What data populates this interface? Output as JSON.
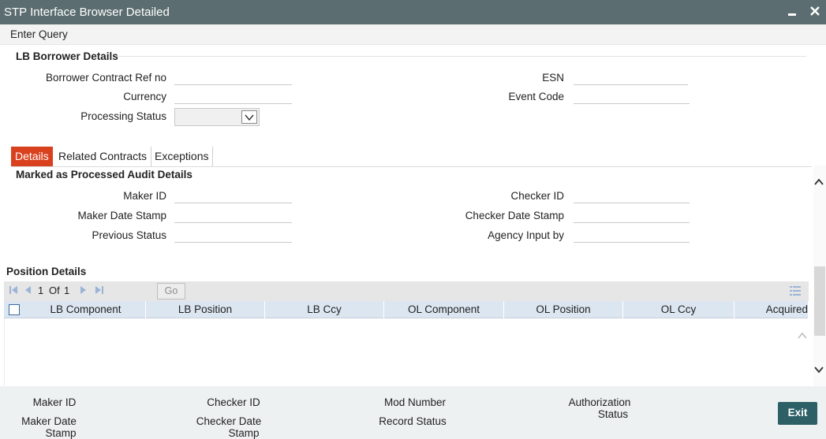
{
  "window": {
    "title": "STP Interface Browser Detailed",
    "minimize_glyph": "▬",
    "close_glyph": "✕"
  },
  "menu": {
    "enter_query": "Enter Query"
  },
  "borrower": {
    "section_title": "LB Borrower Details",
    "contract_ref_label": "Borrower Contract Ref no",
    "contract_ref_value": "",
    "currency_label": "Currency",
    "currency_value": "",
    "processing_status_label": "Processing Status",
    "processing_status_value": "",
    "esn_label": "ESN",
    "esn_value": "",
    "event_code_label": "Event Code",
    "event_code_value": ""
  },
  "tabs": [
    {
      "label": "Details",
      "active": true
    },
    {
      "label": "Related Contracts",
      "active": false
    },
    {
      "label": "Exceptions",
      "active": false
    }
  ],
  "audit": {
    "section_title": "Marked as Processed Audit Details",
    "maker_id_label": "Maker ID",
    "maker_date_label": "Maker Date Stamp",
    "previous_status_label": "Previous Status",
    "checker_id_label": "Checker ID",
    "checker_date_label": "Checker Date Stamp",
    "agency_input_label": "Agency Input by"
  },
  "position": {
    "section_title": "Position Details",
    "current_page": "1",
    "of_label": "Of",
    "total_pages": "1",
    "go_label": "Go",
    "columns": [
      "LB Component",
      "LB Position",
      "LB Ccy",
      "OL Component",
      "OL Position",
      "OL Ccy",
      "Acquired"
    ],
    "rows": []
  },
  "footer": {
    "maker_id": "Maker ID",
    "maker_date_line1": "Maker Date",
    "maker_date_line2": "Stamp",
    "checker_id": "Checker ID",
    "checker_date_line1": "Checker Date",
    "checker_date_line2": "Stamp",
    "mod_number": "Mod Number",
    "record_status": "Record Status",
    "authorization_line1": "Authorization",
    "authorization_line2": "Status",
    "exit_label": "Exit"
  },
  "colors": {
    "titlebar": "#5b6d70",
    "active_tab": "#d9411e",
    "grid_header": "#dce6f1",
    "exit_button": "#2d5f66",
    "footer": "#eef1f2"
  }
}
